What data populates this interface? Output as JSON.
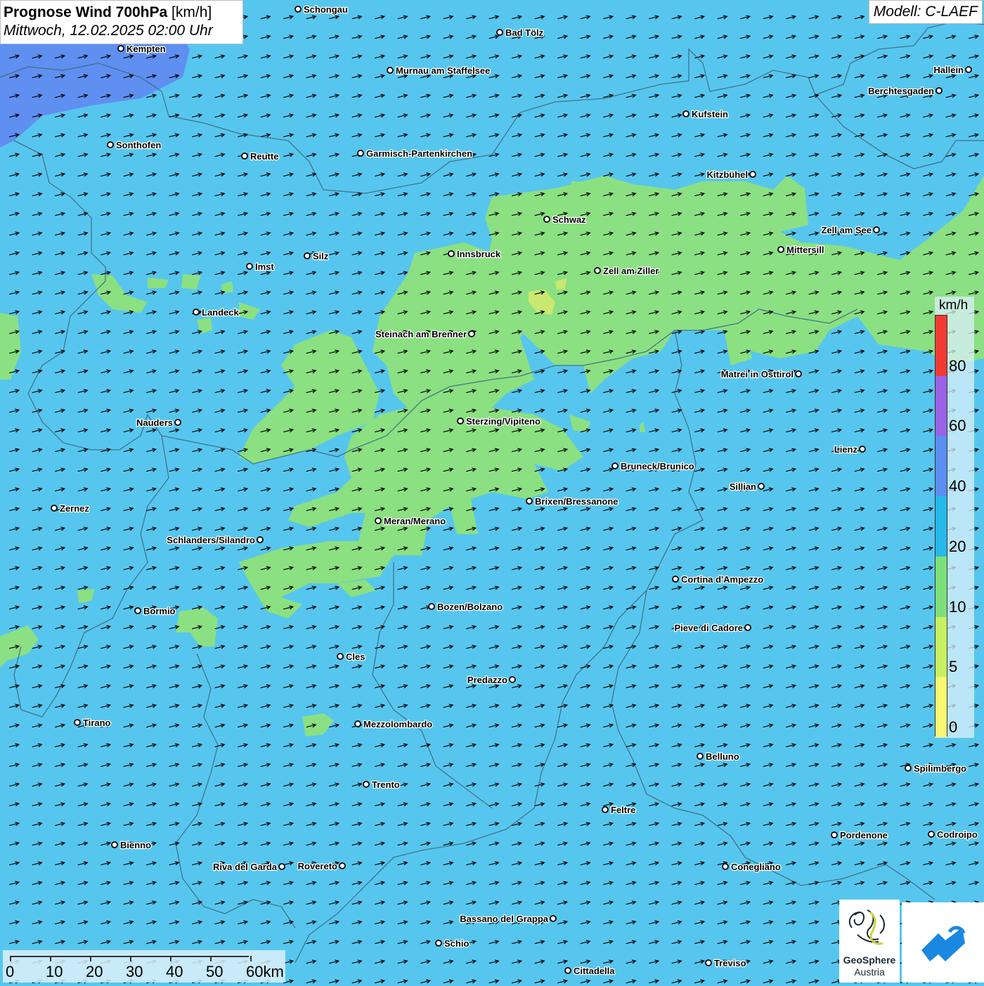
{
  "title": {
    "main_bold": "Prognose Wind 700hPa",
    "unit": "[km/h]",
    "date": "Mittwoch, 12.02.2025 02:00 Uhr"
  },
  "model": "Modell: C-LAEF",
  "legend": {
    "unit": "km/h",
    "labels": [
      "80",
      "60",
      "40",
      "20",
      "10",
      "5",
      "0"
    ],
    "colors": [
      "#f33a32",
      "#9a62e6",
      "#5a8ef0",
      "#27b8ea",
      "#7ee07a",
      "#c8f060",
      "#f8f870"
    ]
  },
  "scale_bar": {
    "labels": [
      "0",
      "10",
      "20",
      "30",
      "40",
      "50",
      "60km"
    ]
  },
  "logo": {
    "name": "GeoSphere",
    "sub": "Austria"
  },
  "colors": {
    "sea_blue": "#57c6ee",
    "light_green": "#8ee27c",
    "yellow_green": "#c8e870",
    "deep_blue": "#5a8ef0",
    "border": "#3d6c84",
    "arrow": "#000000"
  },
  "wind_field": {
    "direction": "east-northeast"
  },
  "cities": [
    {
      "name": "Schongau"
    },
    {
      "name": "Bad Tölz"
    },
    {
      "name": "Kempten"
    },
    {
      "name": "Murnau am Staffelsee"
    },
    {
      "name": "Hallein"
    },
    {
      "name": "Berchtesgaden"
    },
    {
      "name": "Kufstein"
    },
    {
      "name": "Sonthofen"
    },
    {
      "name": "Reutte"
    },
    {
      "name": "Garmisch-Partenkirchen"
    },
    {
      "name": "Kitzbühel"
    },
    {
      "name": "Schwaz"
    },
    {
      "name": "Zell am See"
    },
    {
      "name": "Mittersill"
    },
    {
      "name": "Innsbruck"
    },
    {
      "name": "Silz"
    },
    {
      "name": "Imst"
    },
    {
      "name": "Zell am Ziller"
    },
    {
      "name": "Landeck"
    },
    {
      "name": "Steinach am Brenner"
    },
    {
      "name": "Matrei in Osttirol"
    },
    {
      "name": "Nauders"
    },
    {
      "name": "Sterzing/Vipiteno"
    },
    {
      "name": "Lienz"
    },
    {
      "name": "Bruneck/Brunico"
    },
    {
      "name": "Sillian"
    },
    {
      "name": "Brixen/Bressanone"
    },
    {
      "name": "Zernez"
    },
    {
      "name": "Meran/Merano"
    },
    {
      "name": "Schlanders/Silandro"
    },
    {
      "name": "Cortina d'Ampezzo"
    },
    {
      "name": "Bozen/Bolzano"
    },
    {
      "name": "Bormio"
    },
    {
      "name": "Pieve di Cadore"
    },
    {
      "name": "Cles"
    },
    {
      "name": "Predazzo"
    },
    {
      "name": "Tirano"
    },
    {
      "name": "Mezzolombardo"
    },
    {
      "name": "Belluno"
    },
    {
      "name": "Spilimbergo"
    },
    {
      "name": "Trento"
    },
    {
      "name": "Feltre"
    },
    {
      "name": "Pordenone"
    },
    {
      "name": "Codroipo"
    },
    {
      "name": "Bienno"
    },
    {
      "name": "Riva del Garda"
    },
    {
      "name": "Rovereto"
    },
    {
      "name": "Conegliano"
    },
    {
      "name": "Bassano del Grappa"
    },
    {
      "name": "Schio"
    },
    {
      "name": "Treviso"
    },
    {
      "name": "Cittadella"
    }
  ]
}
